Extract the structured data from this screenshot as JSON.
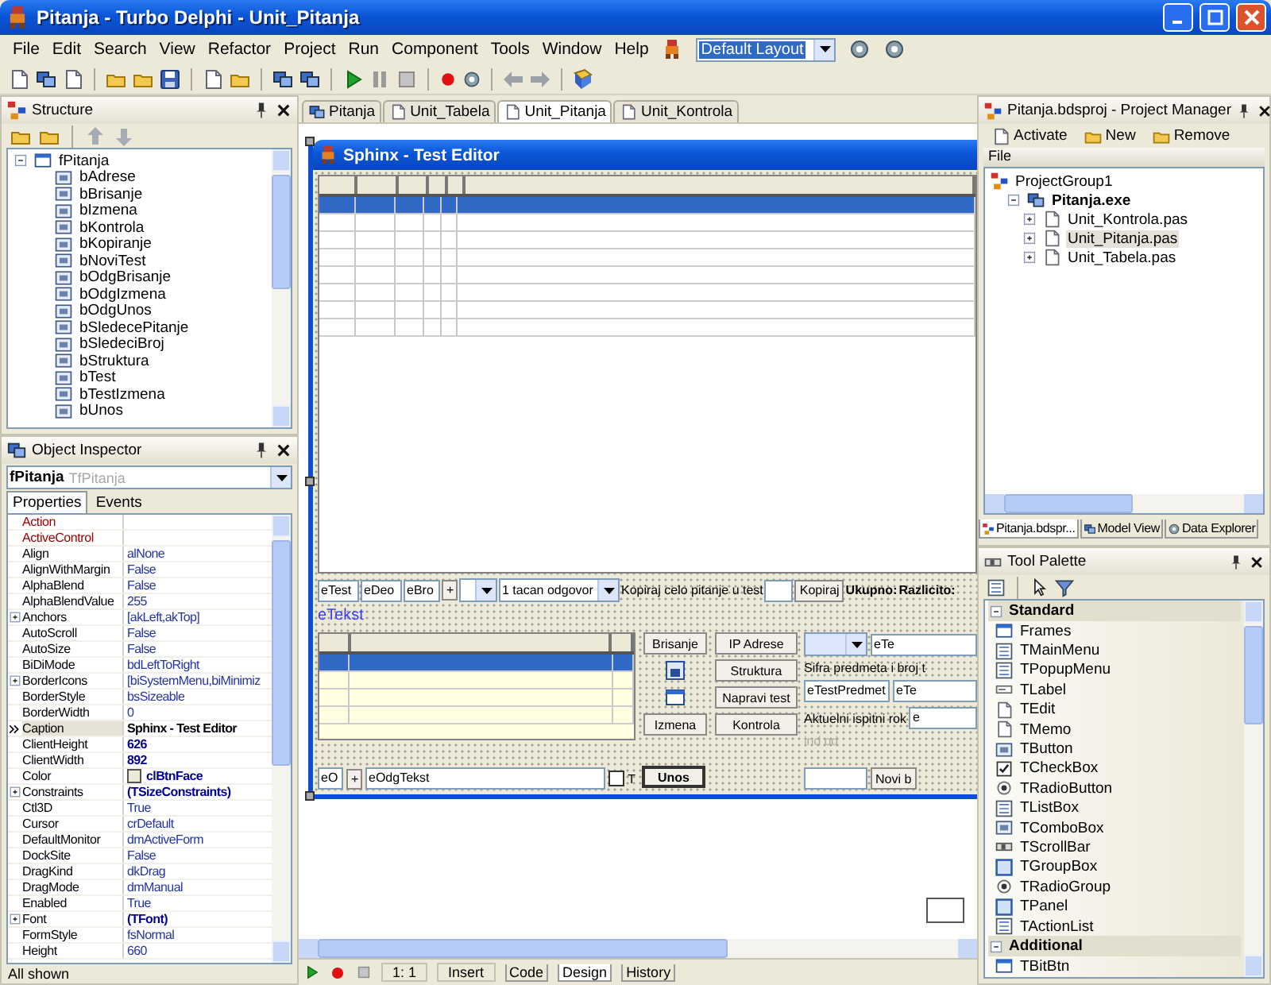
{
  "window": {
    "title": "Pitanja - Turbo Delphi - Unit_Pitanja"
  },
  "menu": [
    "File",
    "Edit",
    "Search",
    "View",
    "Refactor",
    "Project",
    "Run",
    "Component",
    "Tools",
    "Window",
    "Help"
  ],
  "layout_combo": {
    "value": "Default Layout"
  },
  "structure": {
    "title": "Structure",
    "tree": {
      "label": "fPitanja",
      "expanded": true,
      "children": [
        {
          "label": "bAdrese"
        },
        {
          "label": "bBrisanje"
        },
        {
          "label": "bIzmena"
        },
        {
          "label": "bKontrola"
        },
        {
          "label": "bKopiranje"
        },
        {
          "label": "bNoviTest"
        },
        {
          "label": "bOdgBrisanje"
        },
        {
          "label": "bOdgIzmena"
        },
        {
          "label": "bOdgUnos"
        },
        {
          "label": "bSledecePitanje"
        },
        {
          "label": "bSledeciBroj"
        },
        {
          "label": "bStruktura"
        },
        {
          "label": "bTest"
        },
        {
          "label": "bTestIzmena"
        },
        {
          "label": "bUnos"
        }
      ]
    }
  },
  "object_inspector": {
    "title": "Object Inspector",
    "object": "fPitanja",
    "object_type": "TfPitanja",
    "tabs": [
      {
        "label": "Properties",
        "selected": true
      },
      {
        "label": "Events",
        "selected": false
      }
    ],
    "properties": [
      {
        "name": "Action",
        "kind": "reference",
        "expandable": false,
        "selected": false
      },
      {
        "name": "ActiveControl",
        "kind": "reference",
        "expandable": false,
        "selected": false
      },
      {
        "name": "Align",
        "value": "alNone",
        "kind": "plain",
        "expandable": false,
        "selected": false
      },
      {
        "name": "AlignWithMargin",
        "value": "False",
        "kind": "plain",
        "expandable": false,
        "selected": false
      },
      {
        "name": "AlphaBlend",
        "value": "False",
        "kind": "plain",
        "expandable": false,
        "selected": false
      },
      {
        "name": "AlphaBlendValue",
        "value": "255",
        "kind": "plain",
        "expandable": false,
        "selected": false
      },
      {
        "name": "Anchors",
        "value": "[akLeft,akTop]",
        "kind": "plain",
        "expandable": true,
        "selected": false
      },
      {
        "name": "AutoScroll",
        "value": "False",
        "kind": "plain",
        "expandable": false,
        "selected": false
      },
      {
        "name": "AutoSize",
        "value": "False",
        "kind": "plain",
        "expandable": false,
        "selected": false
      },
      {
        "name": "BiDiMode",
        "value": "bdLeftToRight",
        "kind": "plain",
        "expandable": false,
        "selected": false
      },
      {
        "name": "BorderIcons",
        "value": "[biSystemMenu,biMinimiz",
        "kind": "plain",
        "expandable": true,
        "selected": false
      },
      {
        "name": "BorderStyle",
        "value": "bsSizeable",
        "kind": "plain",
        "expandable": false,
        "selected": false
      },
      {
        "name": "BorderWidth",
        "value": "0",
        "kind": "plain",
        "expandable": false,
        "selected": false
      },
      {
        "name": "Caption",
        "value": "Sphinx - Test Editor",
        "kind": "modified",
        "expandable": false,
        "selected": true
      },
      {
        "name": "ClientHeight",
        "value": "626",
        "kind": "modified",
        "expandable": false,
        "selected": false
      },
      {
        "name": "ClientWidth",
        "value": "892",
        "kind": "modified",
        "expandable": false,
        "selected": false
      },
      {
        "name": "Color",
        "value": "clBtnFace",
        "kind": "color",
        "expandable": false,
        "selected": false
      },
      {
        "name": "Constraints",
        "value": "(TSizeConstraints)",
        "kind": "modified",
        "expandable": true,
        "selected": false
      },
      {
        "name": "Ctl3D",
        "value": "True",
        "kind": "plain",
        "expandable": false,
        "selected": false
      },
      {
        "name": "Cursor",
        "value": "crDefault",
        "kind": "plain",
        "expandable": false,
        "selected": false
      },
      {
        "name": "DefaultMonitor",
        "value": "dmActiveForm",
        "kind": "plain",
        "expandable": false,
        "selected": false
      },
      {
        "name": "DockSite",
        "value": "False",
        "kind": "plain",
        "expandable": false,
        "selected": false
      },
      {
        "name": "DragKind",
        "value": "dkDrag",
        "kind": "plain",
        "expandable": false,
        "selected": false
      },
      {
        "name": "DragMode",
        "value": "dmManual",
        "kind": "plain",
        "expandable": false,
        "selected": false
      },
      {
        "name": "Enabled",
        "value": "True",
        "kind": "plain",
        "expandable": false,
        "selected": false
      },
      {
        "name": "Font",
        "value": "(TFont)",
        "kind": "modified",
        "expandable": true,
        "selected": false
      },
      {
        "name": "FormStyle",
        "value": "fsNormal",
        "kind": "plain",
        "expandable": false,
        "selected": false
      },
      {
        "name": "Height",
        "value": "660",
        "kind": "plain",
        "expandable": false,
        "selected": false
      }
    ],
    "status": "All shown"
  },
  "editor": {
    "tabs": [
      {
        "label": "Pitanja",
        "selected": false
      },
      {
        "label": "Unit_Tabela",
        "selected": false
      },
      {
        "label": "Unit_Pitanja",
        "selected": true
      },
      {
        "label": "Unit_Kontrola",
        "selected": false
      }
    ],
    "form": {
      "title": "Sphinx - Test Editor",
      "top_grid": {
        "rows": [
          {
            "selected": true
          },
          {
            "selected": false
          },
          {
            "selected": false
          },
          {
            "selected": false
          },
          {
            "selected": false
          },
          {
            "selected": false
          },
          {
            "selected": false
          },
          {
            "selected": false
          }
        ]
      },
      "edit_row": {
        "fields": [
          "eTest",
          "eDeo",
          "eBro"
        ],
        "plus": "+",
        "answer_type": "1 tacan odgovor",
        "copy_label": "Kopiraj celo pitanje u test",
        "copy_button": "Kopiraj",
        "total_label": "Ukupno:",
        "distinct_label": "Razlicito:"
      },
      "text_label": "eTekst",
      "answer_grid": {
        "rows": [
          {
            "selected": true
          },
          {
            "selected": false
          },
          {
            "selected": false
          },
          {
            "selected": false
          }
        ]
      },
      "delete_button": "Brisanje",
      "edit_button": "Izmena",
      "insert_button": {
        "label": "Unos",
        "default": true
      },
      "tool_buttons": [
        "IP Adrese",
        "Struktura",
        "Napravi test",
        "Kontrola"
      ],
      "test_panel": {
        "field_1": "eTe",
        "label_1": "Sifra predmeta i broj t",
        "field_2": "eTestPredmet",
        "field_3": "eTe",
        "label_2": "Aktuelni ispitni rok",
        "field_4": "e",
        "labels": [
          {
            "text": "ind",
            "disabled": true
          },
          {
            "text": "od",
            "disabled": true
          }
        ]
      },
      "answer_row": {
        "field": "eO",
        "plus": "+",
        "text_field": "eOdgTekst",
        "checkbox": {
          "label": "T",
          "checked": false
        },
        "new_button": "Novi b"
      }
    },
    "status": {
      "position": "1:  1",
      "mode": "Insert",
      "tabs": [
        {
          "label": "Code",
          "selected": false
        },
        {
          "label": "Design",
          "selected": true
        },
        {
          "label": "History",
          "selected": false
        }
      ]
    }
  },
  "project_manager": {
    "title": "Pitanja.bdsproj - Project Manager",
    "actions": [
      "Activate",
      "New",
      "Remove"
    ],
    "column": "File",
    "tree": {
      "label": "ProjectGroup1",
      "selected": false,
      "children": [
        {
          "label": "Pitanja.exe",
          "active": true,
          "expanded": true,
          "selected": false,
          "children": [
            {
              "label": "Unit_Kontrola.pas",
              "expanded": false,
              "selected": false
            },
            {
              "label": "Unit_Pitanja.pas",
              "expanded": false,
              "selected": true
            },
            {
              "label": "Unit_Tabela.pas",
              "expanded": false,
              "selected": false
            }
          ]
        }
      ]
    },
    "tabs": [
      {
        "label": "Pitanja.bdspr...",
        "selected": true
      },
      {
        "label": "Model View",
        "selected": false
      },
      {
        "label": "Data Explorer",
        "selected": false
      }
    ]
  },
  "tool_palette": {
    "title": "Tool Palette",
    "categories": [
      {
        "name": "Standard",
        "expanded": true,
        "items": [
          "Frames",
          "TMainMenu",
          "TPopupMenu",
          "TLabel",
          "TEdit",
          "TMemo",
          "TButton",
          "TCheckBox",
          "TRadioButton",
          "TListBox",
          "TComboBox",
          "TScrollBar",
          "TGroupBox",
          "TRadioGroup",
          "TPanel",
          "TActionList"
        ]
      },
      {
        "name": "Additional",
        "expanded": true,
        "items": [
          "TBitBtn"
        ]
      }
    ]
  }
}
